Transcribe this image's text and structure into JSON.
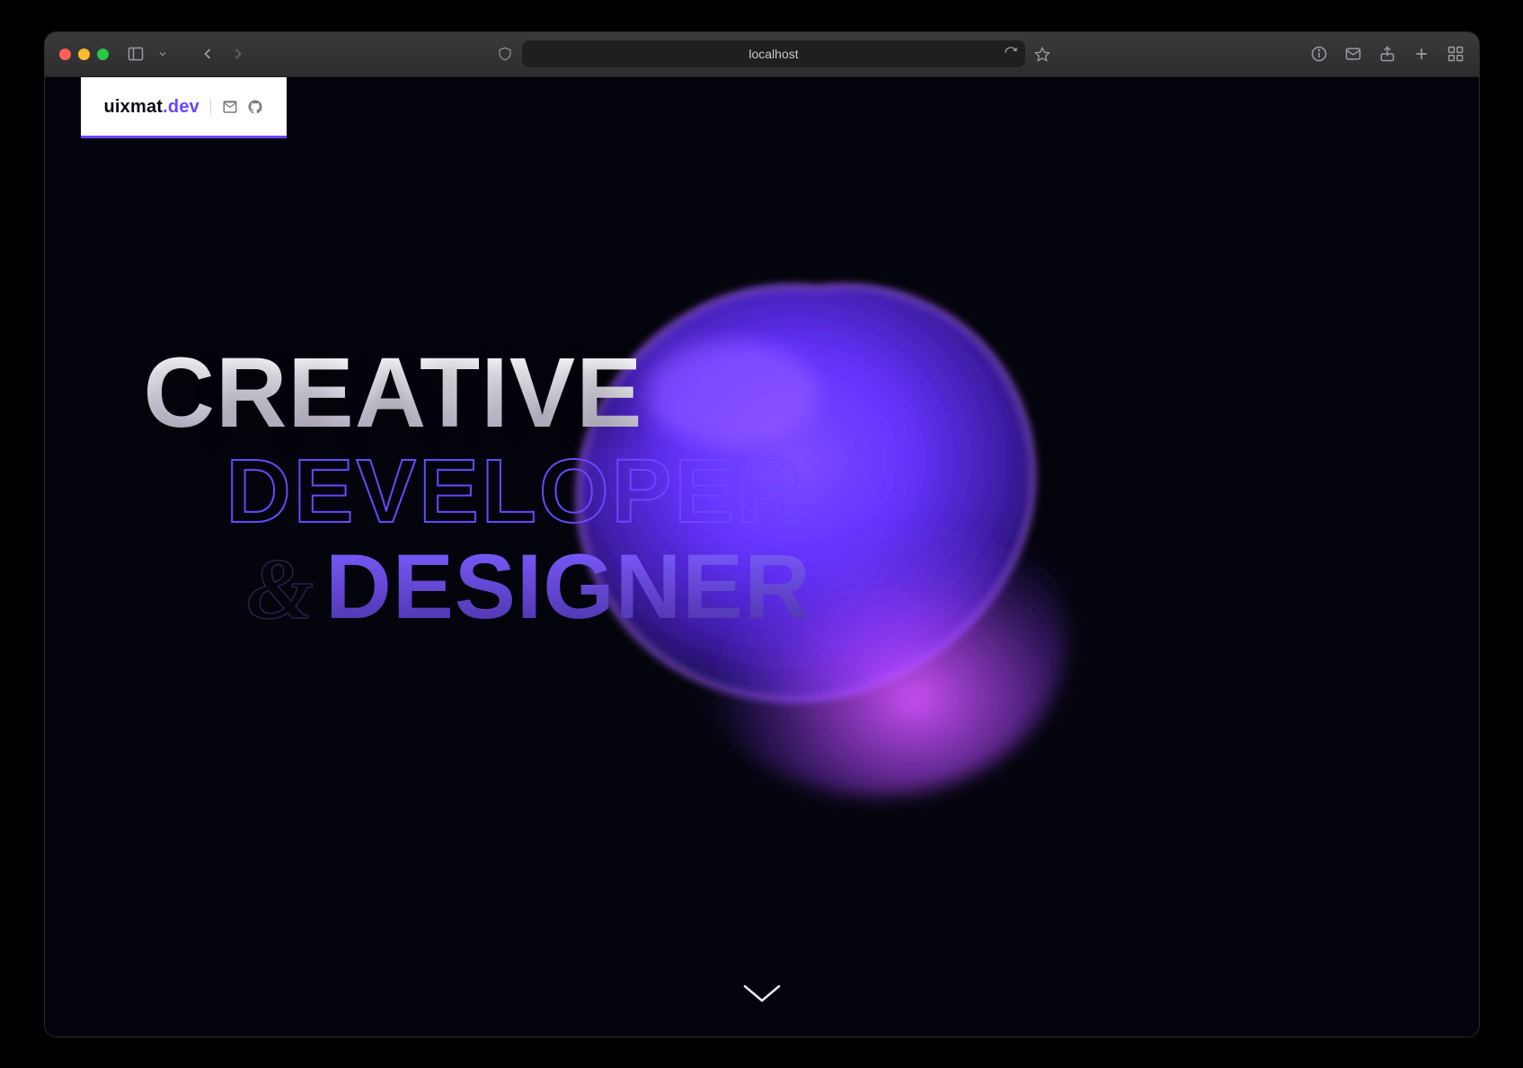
{
  "browser": {
    "url": "localhost"
  },
  "brand": {
    "name": "uixmat",
    "suffix": ".dev"
  },
  "hero": {
    "line1": "CREATIVE",
    "line2": "DEVELOPER",
    "amp": "&",
    "line3": "DESIGNER"
  },
  "colors": {
    "accent": "#6b46ff",
    "bg": "#04040c"
  }
}
